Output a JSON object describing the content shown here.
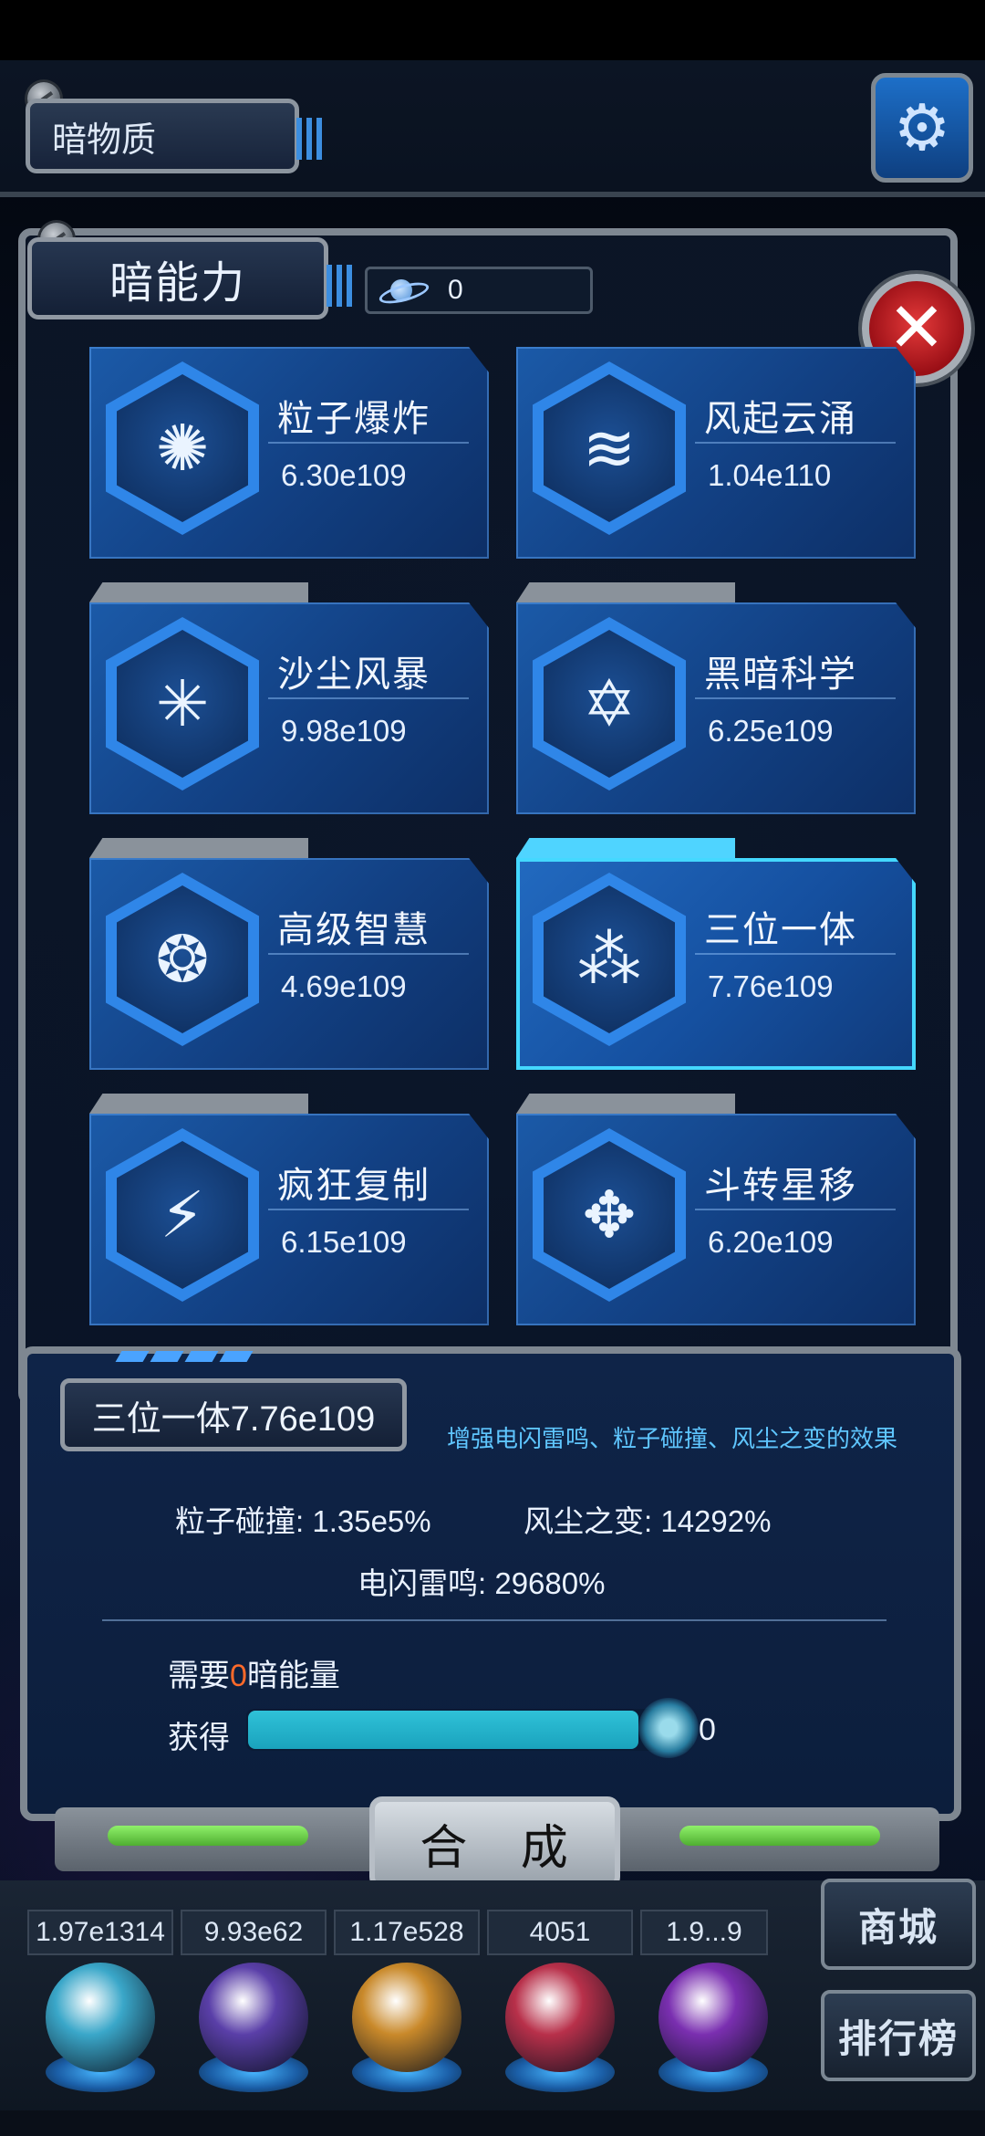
{
  "top": {
    "title": "暗物质",
    "settings_icon": "gear-icon"
  },
  "panel": {
    "title": "暗能力",
    "counter_value": "0",
    "counter_icon": "planet-icon",
    "close_icon": "close-icon"
  },
  "skills": [
    {
      "name": "粒子爆炸",
      "value": "6.30e109",
      "icon": "explosion-icon"
    },
    {
      "name": "风起云涌",
      "value": "1.04e110",
      "icon": "tornado-icon"
    },
    {
      "name": "沙尘风暴",
      "value": "9.98e109",
      "icon": "shatter-icon"
    },
    {
      "name": "黑暗科学",
      "value": "6.25e109",
      "icon": "hexagram-icon"
    },
    {
      "name": "高级智慧",
      "value": "4.69e109",
      "icon": "brain-icon"
    },
    {
      "name": "三位一体",
      "value": "7.76e109",
      "icon": "trinity-icon"
    },
    {
      "name": "疯狂复制",
      "value": "6.15e109",
      "icon": "lightning-icon"
    },
    {
      "name": "斗转星移",
      "value": "6.20e109",
      "icon": "vortex-icon"
    }
  ],
  "detail": {
    "title": "三位一体7.76e109",
    "description": "增强电闪雷鸣、粒子碰撞、风尘之变的效果",
    "stats": {
      "particle_collision": "粒子碰撞: 1.35e5%",
      "wind_dust_change": "风尘之变: 14292%",
      "thunder_lightning": "电闪雷鸣: 29680%"
    },
    "need_prefix": "需要",
    "need_amount": "0",
    "need_suffix": "暗能量",
    "get_label": "获得",
    "get_value": "0",
    "progress_fraction": 0.88
  },
  "synthesize_label": "合 成",
  "resources": [
    {
      "value": "1.97e1314",
      "color": "#3aa7c9"
    },
    {
      "value": "9.93e62",
      "color": "#5a3fa8"
    },
    {
      "value": "1.17e528",
      "color": "#c9892a"
    },
    {
      "value": "4051",
      "color": "#b8304a"
    },
    {
      "value": "1.9...9",
      "color": "#7a2fb0"
    }
  ],
  "side_buttons": {
    "shop": "商城",
    "rank": "排行榜"
  }
}
